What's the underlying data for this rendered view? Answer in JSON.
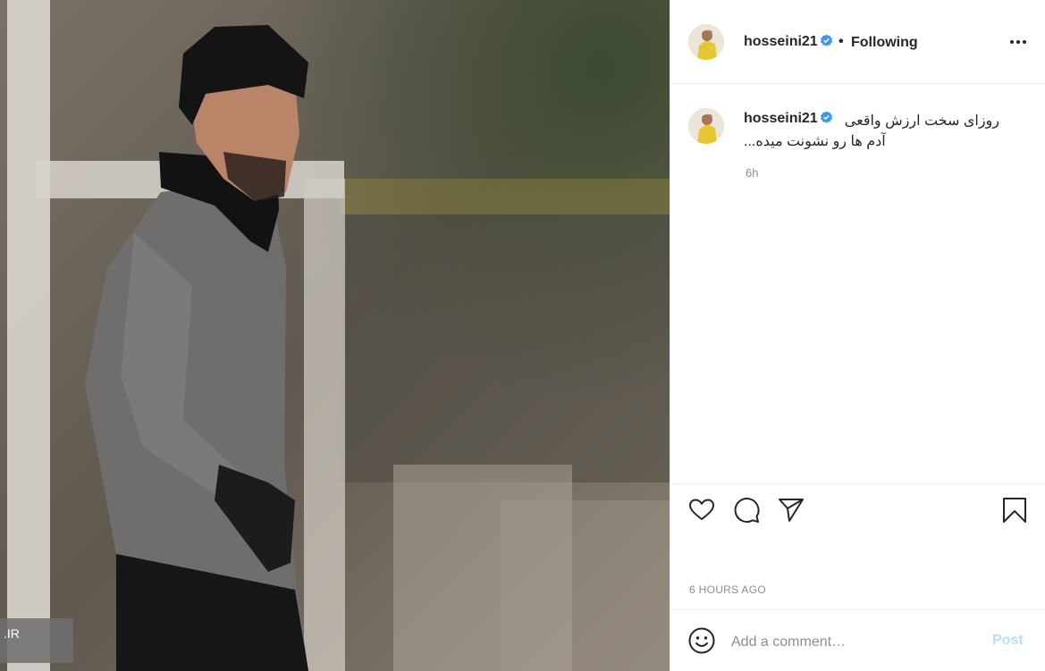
{
  "post": {
    "username": "hosseini21",
    "verified_icon": "verified-badge-icon",
    "separator": "•",
    "follow_status": "Following",
    "more_icon": "more-options-icon",
    "caption_line1": "روزای سخت ارزش واقعی",
    "caption_line2": "آدم ها رو نشونت میده...",
    "relative_time": "6h",
    "timestamp": "6 HOURS AGO"
  },
  "photo": {
    "watermark": ".IR"
  },
  "actions": {
    "like_icon": "heart-icon",
    "comment_icon": "comment-bubble-icon",
    "share_icon": "paper-plane-icon",
    "save_icon": "bookmark-icon"
  },
  "comment_box": {
    "emoji_icon": "emoji-smiley-icon",
    "placeholder": "Add a comment…",
    "post_label": "Post"
  },
  "colors": {
    "verified_blue": "#3897f0",
    "secondary_text": "#8e8e8e",
    "post_disabled": "#b2dffc",
    "border": "#efefef"
  }
}
